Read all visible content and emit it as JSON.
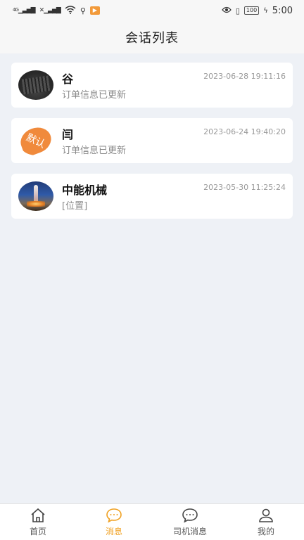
{
  "status_bar": {
    "network": "4G",
    "time": "5:00",
    "battery": "100"
  },
  "header": {
    "title": "会话列表"
  },
  "conversations": [
    {
      "name": "谷",
      "time": "2023-06-28 19:11:16",
      "message": "订单信息已更新",
      "avatar": "keyboard-photo"
    },
    {
      "name": "闫",
      "time": "2023-06-24 19:40:20",
      "message": "订单信息已更新",
      "avatar": "default-avatar",
      "avatar_text": "默认"
    },
    {
      "name": "中能机械",
      "time": "2023-05-30 11:25:24",
      "message": "[位置]",
      "avatar": "shuttle-photo"
    }
  ],
  "nav": {
    "items": [
      {
        "label": "首页",
        "icon": "home-icon"
      },
      {
        "label": "消息",
        "icon": "chat-icon"
      },
      {
        "label": "司机消息",
        "icon": "chat-icon"
      },
      {
        "label": "我的",
        "icon": "user-icon"
      }
    ],
    "active_index": 1,
    "active_color": "#f0a020"
  }
}
